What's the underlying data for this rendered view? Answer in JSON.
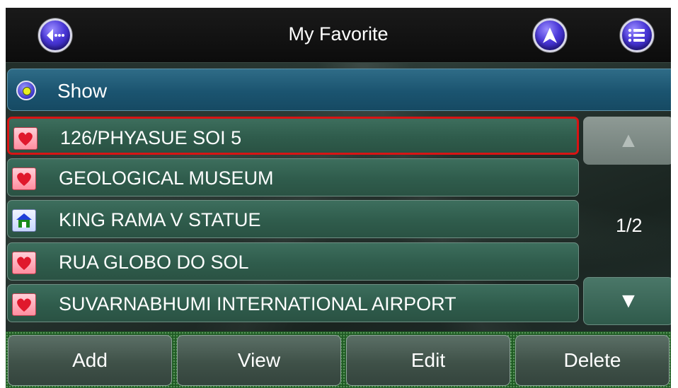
{
  "header": {
    "title": "My Favorite",
    "back_icon": "back-arrow-icon",
    "navigate_icon": "compass-arrow-icon",
    "menu_icon": "list-menu-icon"
  },
  "show": {
    "label": "Show"
  },
  "favorites": [
    {
      "label": "126/PHYASUE SOI 5",
      "icon": "heart-icon",
      "selected": true
    },
    {
      "label": "GEOLOGICAL MUSEUM",
      "icon": "heart-icon",
      "selected": false
    },
    {
      "label": "KING RAMA V STATUE",
      "icon": "home-icon",
      "selected": false
    },
    {
      "label": "RUA GLOBO DO SOL",
      "icon": "heart-icon",
      "selected": false
    },
    {
      "label": "SUVARNABHUMI INTERNATIONAL AIRPORT",
      "icon": "heart-icon",
      "selected": false
    }
  ],
  "pagination": {
    "text": "1/2",
    "up_arrow": "▲",
    "down_arrow": "▼"
  },
  "actions": {
    "add": "Add",
    "view": "View",
    "edit": "Edit",
    "delete": "Delete"
  },
  "colors": {
    "selected_border": "#d81414",
    "accent_blue": "#4a38d8"
  }
}
